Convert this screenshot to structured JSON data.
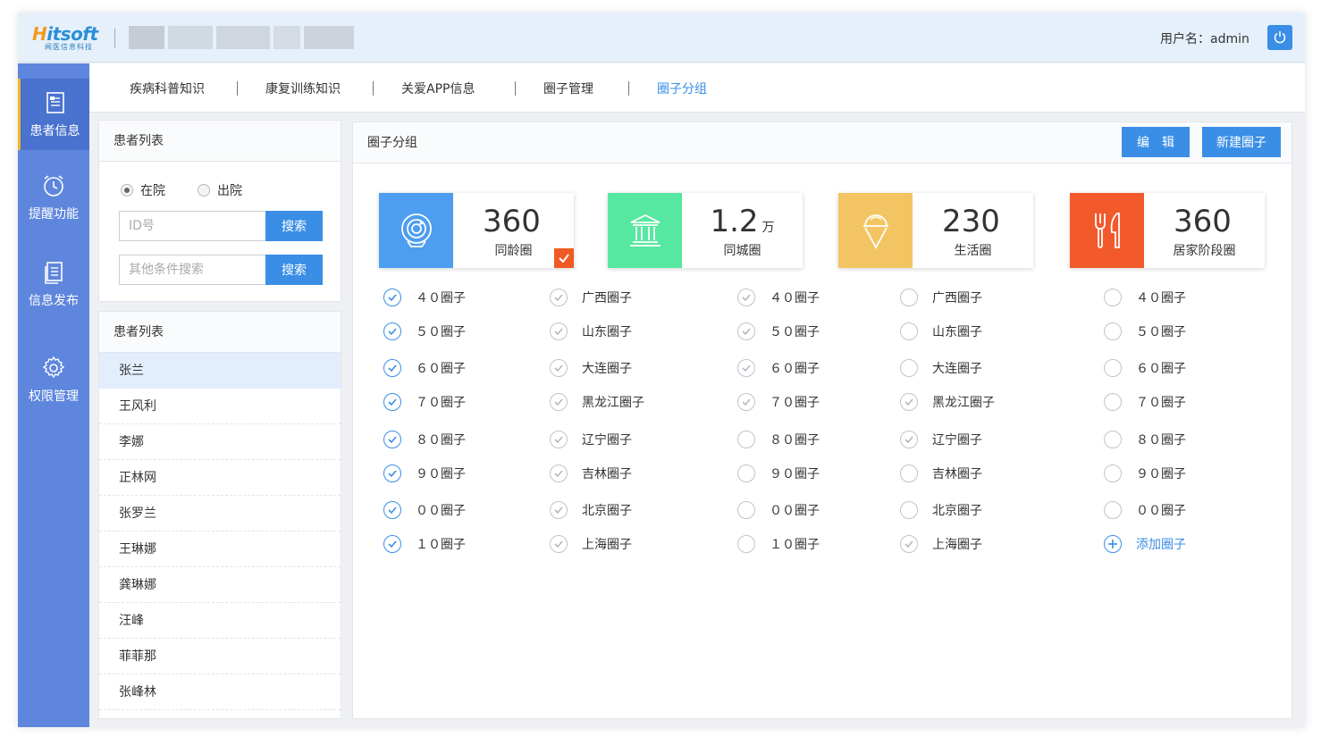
{
  "header": {
    "logo_main_a": "H",
    "logo_main_b": "itsoft",
    "logo_sub": "闻医信息科技",
    "user_label": "用户名：admin"
  },
  "sidebar": {
    "items": [
      {
        "label": "患者信息",
        "icon": "document-icon",
        "active": true
      },
      {
        "label": "提醒功能",
        "icon": "alarm-clock-icon",
        "active": false
      },
      {
        "label": "信息发布",
        "icon": "publish-icon",
        "active": false
      },
      {
        "label": "权限管理",
        "icon": "gear-icon",
        "active": false
      }
    ]
  },
  "topnav": {
    "items": [
      "疾病科普知识",
      "康复训练知识",
      "关爱APP信息",
      "圈子管理",
      "圈子分组"
    ],
    "active_index": 4
  },
  "filter_panel": {
    "title": "患者列表",
    "radio_in": "在院",
    "radio_out": "出院",
    "id_placeholder": "ID号",
    "other_placeholder": "其他条件搜索",
    "search_label": "搜索"
  },
  "patient_panel": {
    "title": "患者列表",
    "patients": [
      "张兰",
      "王风利",
      "李娜",
      "正林网",
      "张罗兰",
      "王琳娜",
      "龚琳娜",
      "汪峰",
      "菲菲那",
      "张峰林"
    ],
    "active_index": 0
  },
  "main": {
    "title": "圈子分组",
    "edit_label": "编　辑",
    "new_label": "新建圈子",
    "cards": [
      {
        "value": "360",
        "unit": "",
        "label": "同龄圈",
        "color": "#4d9ef0",
        "icon": "webcam-icon",
        "selected": true
      },
      {
        "value": "1.2",
        "unit": "万",
        "label": "同城圈",
        "color": "#56e7a0",
        "icon": "building-icon",
        "selected": false
      },
      {
        "value": "230",
        "unit": "",
        "label": "生活圈",
        "color": "#f3c562",
        "icon": "ice-cream-icon",
        "selected": false
      },
      {
        "value": "360",
        "unit": "",
        "label": "居家阶段圈",
        "color": "#f2592b",
        "icon": "fork-knife-icon",
        "selected": false
      }
    ],
    "columns": [
      [
        {
          "label": "４０圈子",
          "state": "blue"
        },
        {
          "label": "５０圈子",
          "state": "blue"
        },
        {
          "label": "６０圈子",
          "state": "blue"
        },
        {
          "label": "７０圈子",
          "state": "blue"
        },
        {
          "label": "８０圈子",
          "state": "blue"
        },
        {
          "label": "９０圈子",
          "state": "blue"
        },
        {
          "label": "００圈子",
          "state": "blue"
        },
        {
          "label": "１０圈子",
          "state": "blue"
        }
      ],
      [
        {
          "label": "广西圈子",
          "state": "gray"
        },
        {
          "label": "山东圈子",
          "state": "gray"
        },
        {
          "label": "大连圈子",
          "state": "gray"
        },
        {
          "label": "黑龙江圈子",
          "state": "gray"
        },
        {
          "label": "辽宁圈子",
          "state": "gray"
        },
        {
          "label": "吉林圈子",
          "state": "gray"
        },
        {
          "label": "北京圈子",
          "state": "gray"
        },
        {
          "label": "上海圈子",
          "state": "gray"
        }
      ],
      [
        {
          "label": "４０圈子",
          "state": "gray"
        },
        {
          "label": "５０圈子",
          "state": "gray"
        },
        {
          "label": "６０圈子",
          "state": "gray"
        },
        {
          "label": "７０圈子",
          "state": "gray"
        },
        {
          "label": "８０圈子",
          "state": "empty"
        },
        {
          "label": "９０圈子",
          "state": "empty"
        },
        {
          "label": "００圈子",
          "state": "empty"
        },
        {
          "label": "１０圈子",
          "state": "empty"
        }
      ],
      [
        {
          "label": "广西圈子",
          "state": "empty"
        },
        {
          "label": "山东圈子",
          "state": "empty"
        },
        {
          "label": "大连圈子",
          "state": "empty"
        },
        {
          "label": "黑龙江圈子",
          "state": "gray"
        },
        {
          "label": "辽宁圈子",
          "state": "gray"
        },
        {
          "label": "吉林圈子",
          "state": "empty"
        },
        {
          "label": "北京圈子",
          "state": "empty"
        },
        {
          "label": "上海圈子",
          "state": "gray"
        }
      ],
      [
        {
          "label": "４０圈子",
          "state": "empty"
        },
        {
          "label": "５０圈子",
          "state": "empty"
        },
        {
          "label": "６０圈子",
          "state": "empty"
        },
        {
          "label": "７０圈子",
          "state": "empty"
        },
        {
          "label": "８０圈子",
          "state": "empty"
        },
        {
          "label": "９０圈子",
          "state": "empty"
        },
        {
          "label": "００圈子",
          "state": "empty"
        },
        {
          "label": "添加圈子",
          "state": "add"
        }
      ]
    ]
  }
}
